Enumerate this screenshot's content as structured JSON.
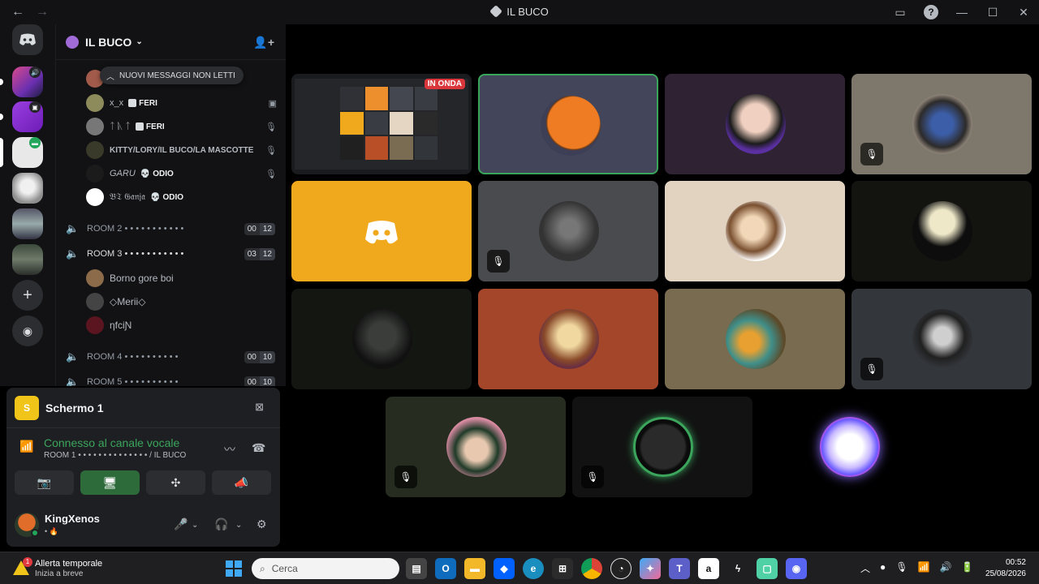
{
  "titlebar": {
    "title": "IL BUCO"
  },
  "channel": {
    "server_name": "IL BUCO",
    "new_messages_pill": "NUOVI MESSAGGI NON LETTI",
    "members_top": [
      {
        "name": "x_x",
        "tag": "FERI"
      },
      {
        "name": "ᛏ ᚣ ᛏ",
        "tag": "FERI"
      },
      {
        "name": "KITTY/LORY/IL BUCO/LA MASCOTTE",
        "tag": ""
      },
      {
        "name": "GARU",
        "tag": "ODIO"
      },
      {
        "name": "𝔅𝔗 𝔊𝔞𝔫𝔧𝔞",
        "tag": "ODIO"
      }
    ],
    "rooms": [
      {
        "name": "ROOM 2 • • • • • • • • • • •",
        "a": "00",
        "b": "12"
      },
      {
        "name": "ROOM 3 • • • • • • • • • • •",
        "a": "03",
        "b": "12"
      },
      {
        "name": "ROOM 4 • • • • • • • • • •",
        "a": "00",
        "b": "10"
      },
      {
        "name": "ROOM 5 • • • • • • • • • •",
        "a": "00",
        "b": "10"
      }
    ],
    "room3_members": [
      "Borno gore boi",
      "◇Merii◇",
      "ηfciƝ"
    ]
  },
  "panel": {
    "stream_icon_letter": "S",
    "stream_name": "Schermo 1",
    "connected_text": "Connesso al canale vocale",
    "connected_sub": "ROOM 1 • • • • • • • • • • • • • • / IL BUCO",
    "username": "KingXenos",
    "status_text": "• 🔥"
  },
  "stage": {
    "live_badge": "IN ONDA"
  },
  "taskbar": {
    "weather_title": "Allerta temporale",
    "weather_sub": "Inizia a breve",
    "weather_badge": "1",
    "search_placeholder": "Cerca",
    "time": "00:52",
    "date": "25/08/2026"
  },
  "colors": {
    "accent_green": "#3ba55c",
    "live_red": "#da373c",
    "discord_blurple": "#5865f2",
    "stream_yellow": "#f0c419"
  }
}
